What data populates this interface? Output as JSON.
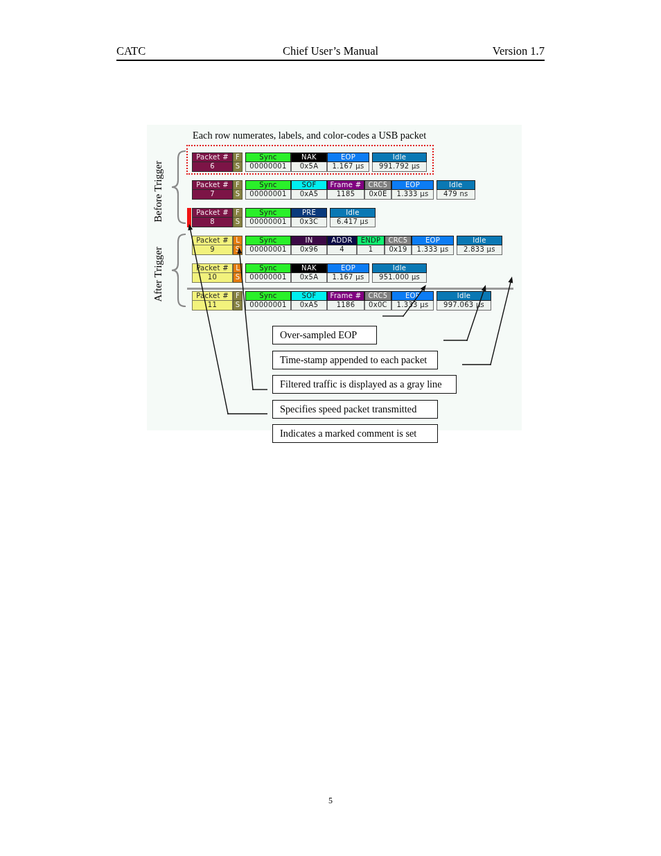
{
  "header": {
    "left": "CATC",
    "center": "Chief User’s Manual",
    "right": "Version 1.7"
  },
  "figure": {
    "caption": "Each row numerates, labels, and color-codes a USB packet",
    "groups": [
      {
        "label": "Before Trigger",
        "kind": "before",
        "rows": [
          {
            "packet_label": "Packet #",
            "number": "6",
            "flag": {
              "top": "F",
              "bottom": "S",
              "color": "#868242"
            },
            "selected": true,
            "marked": false,
            "filtered_before": false,
            "fields": [
              {
                "kind": "sync",
                "name": "Sync",
                "value": "00000001",
                "color": "#2af02a"
              },
              {
                "kind": "pid",
                "name": "NAK",
                "value": "0x5A",
                "color": "#000000"
              },
              {
                "kind": "eop",
                "name": "EOP",
                "value": "1.167 µs",
                "color": "#0c7cf4"
              }
            ],
            "idle": {
              "name": "Idle",
              "value": "991.792 µs"
            }
          },
          {
            "packet_label": "Packet #",
            "number": "7",
            "flag": {
              "top": "F",
              "bottom": "S",
              "color": "#868242"
            },
            "selected": false,
            "marked": false,
            "filtered_before": false,
            "fields": [
              {
                "kind": "sync",
                "name": "Sync",
                "value": "00000001",
                "color": "#2af02a"
              },
              {
                "kind": "pid",
                "name": "SOF",
                "value": "0xA5",
                "color": "#00f0f0"
              },
              {
                "kind": "frame",
                "name": "Frame #",
                "value": "1185",
                "color": "#800080"
              },
              {
                "kind": "crc",
                "name": "CRC5",
                "value": "0x0E",
                "color": "#808080"
              },
              {
                "kind": "eop",
                "name": "EOP",
                "value": "1.333 µs",
                "color": "#0c7cf4"
              }
            ],
            "idle": {
              "name": "Idle",
              "value": "479 ns"
            }
          },
          {
            "packet_label": "Packet #",
            "number": "8",
            "flag": {
              "top": "F",
              "bottom": "S",
              "color": "#868242"
            },
            "selected": false,
            "marked": true,
            "filtered_before": false,
            "fields": [
              {
                "kind": "sync",
                "name": "Sync",
                "value": "00000001",
                "color": "#2af02a"
              },
              {
                "kind": "pid",
                "name": "PRE",
                "value": "0x3C",
                "color": "#0a3a7c"
              }
            ],
            "idle": {
              "name": "Idle",
              "value": "6.417 µs"
            }
          }
        ]
      },
      {
        "label": "After Trigger",
        "kind": "after",
        "rows": [
          {
            "packet_label": "Packet #",
            "number": "9",
            "flag": {
              "top": "L",
              "bottom": "S",
              "color": "#e47c10"
            },
            "selected": false,
            "marked": false,
            "filtered_before": false,
            "fields": [
              {
                "kind": "sync",
                "name": "Sync",
                "value": "00000001",
                "color": "#2af02a"
              },
              {
                "kind": "pid",
                "name": "IN",
                "value": "0x96",
                "color": "#3c0a46"
              },
              {
                "kind": "addr",
                "name": "ADDR",
                "value": "4",
                "color": "#0a0a46"
              },
              {
                "kind": "endp",
                "name": "ENDP",
                "value": "1",
                "color": "#10f070"
              },
              {
                "kind": "crc",
                "name": "CRC5",
                "value": "0x19",
                "color": "#808080"
              },
              {
                "kind": "eop",
                "name": "EOP",
                "value": "1.333 µs",
                "color": "#0c7cf4"
              }
            ],
            "idle": {
              "name": "Idle",
              "value": "2.833 µs"
            }
          },
          {
            "packet_label": "Packet #",
            "number": "10",
            "flag": {
              "top": "L",
              "bottom": "S",
              "color": "#e47c10"
            },
            "selected": false,
            "marked": false,
            "filtered_before": false,
            "fields": [
              {
                "kind": "sync",
                "name": "Sync",
                "value": "00000001",
                "color": "#2af02a"
              },
              {
                "kind": "pid",
                "name": "NAK",
                "value": "0x5A",
                "color": "#000000"
              },
              {
                "kind": "eop",
                "name": "EOP",
                "value": "1.167 µs",
                "color": "#0c7cf4"
              }
            ],
            "idle": {
              "name": "Idle",
              "value": "951.000 µs"
            }
          },
          {
            "packet_label": "Packet #",
            "number": "11",
            "flag": {
              "top": "F",
              "bottom": "S",
              "color": "#868242"
            },
            "selected": false,
            "marked": false,
            "filtered_before": true,
            "fields": [
              {
                "kind": "sync",
                "name": "Sync",
                "value": "00000001",
                "color": "#2af02a"
              },
              {
                "kind": "pid",
                "name": "SOF",
                "value": "0xA5",
                "color": "#00f0f0"
              },
              {
                "kind": "frame",
                "name": "Frame #",
                "value": "1186",
                "color": "#800080"
              },
              {
                "kind": "crc",
                "name": "CRC5",
                "value": "0x0C",
                "color": "#808080"
              },
              {
                "kind": "eop",
                "name": "EOP",
                "value": "1.333 µs",
                "color": "#0c7cf4"
              }
            ],
            "idle": {
              "name": "Idle",
              "value": "997.063 µs"
            }
          }
        ]
      }
    ],
    "callouts": [
      "Over-sampled EOP",
      "Time-stamp appended to each packet",
      "Filtered traffic is displayed as a gray line",
      "Specifies speed packet transmitted",
      "Indicates a marked comment is set"
    ]
  },
  "page_number": "5"
}
